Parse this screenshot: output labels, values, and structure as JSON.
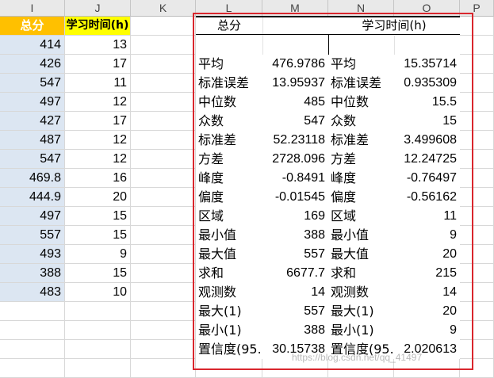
{
  "columns": [
    "I",
    "J",
    "K",
    "L",
    "M",
    "N",
    "O",
    "P"
  ],
  "left_table": {
    "header_i": "总分",
    "header_j": "学习时间(h)",
    "rows": [
      [
        "414",
        "13"
      ],
      [
        "426",
        "17"
      ],
      [
        "547",
        "11"
      ],
      [
        "497",
        "12"
      ],
      [
        "427",
        "17"
      ],
      [
        "487",
        "12"
      ],
      [
        "547",
        "12"
      ],
      [
        "469.8",
        "16"
      ],
      [
        "444.9",
        "20"
      ],
      [
        "497",
        "15"
      ],
      [
        "557",
        "15"
      ],
      [
        "493",
        "9"
      ],
      [
        "388",
        "15"
      ],
      [
        "483",
        "10"
      ]
    ]
  },
  "stats": {
    "title_l": "总分",
    "title_n": "学习时间(h)",
    "rows": [
      [
        "平均",
        "476.9786",
        "平均",
        "15.35714"
      ],
      [
        "标准误差",
        "13.95937",
        "标准误差",
        "0.935309"
      ],
      [
        "中位数",
        "485",
        "中位数",
        "15.5"
      ],
      [
        "众数",
        "547",
        "众数",
        "15"
      ],
      [
        "标准差",
        "52.23118",
        "标准差",
        "3.499608"
      ],
      [
        "方差",
        "2728.096",
        "方差",
        "12.24725"
      ],
      [
        "峰度",
        "-0.8491",
        "峰度",
        "-0.76497"
      ],
      [
        "偏度",
        "-0.01545",
        "偏度",
        "-0.56162"
      ],
      [
        "区域",
        "169",
        "区域",
        "11"
      ],
      [
        "最小值",
        "388",
        "最小值",
        "9"
      ],
      [
        "最大值",
        "557",
        "最大值",
        "20"
      ],
      [
        "求和",
        "6677.7",
        "求和",
        "215"
      ],
      [
        "观测数",
        "14",
        "观测数",
        "14"
      ],
      [
        "最大(1)",
        "557",
        "最大(1)",
        "20"
      ],
      [
        "最小(1)",
        "388",
        "最小(1)",
        "9"
      ],
      [
        "置信度(95.",
        "30.15738",
        "置信度(95.",
        "2.020613"
      ]
    ]
  },
  "colors": {
    "header_highlight": "#ffc000",
    "header_yellow": "#ffff00",
    "selection_blue": "#dce6f2",
    "annotation_red": "#d9262d"
  },
  "watermark": "https://blog.csdn.net/qq_41497"
}
